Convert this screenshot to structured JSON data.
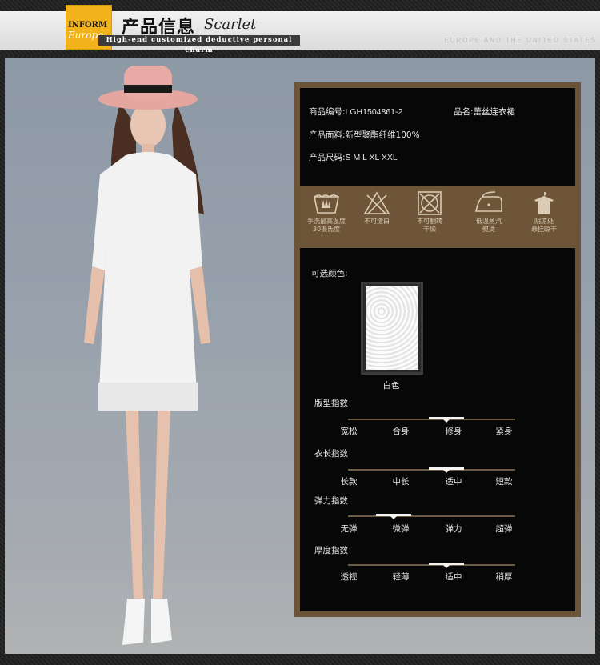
{
  "header": {
    "logo_top": "INFORM",
    "logo_script": "Europe",
    "title_cn": "产品信息",
    "title_en": "Scarlet",
    "subtitle": "High-end customized deductive personal charm",
    "tagline": "EUROPE AND THE UNITED STATES"
  },
  "info": {
    "code_label": "商品编号:",
    "code_value": "LGH1504861-2",
    "name_label": "品名:",
    "name_value": "蕾丝连衣裙",
    "material_label": "产品面料:",
    "material_value": "新型聚酯纤维100%",
    "size_label": "产品尺码:",
    "size_value": "S M L XL XXL"
  },
  "care": [
    {
      "icon": "hand-wash-icon",
      "label1": "手洗最高温度",
      "label2": "30摄氏度"
    },
    {
      "icon": "no-bleach-icon",
      "label1": "不可漂白",
      "label2": ""
    },
    {
      "icon": "no-tumble-dry-icon",
      "label1": "不可翻转",
      "label2": "干燥"
    },
    {
      "icon": "low-iron-icon",
      "label1": "低温蒸汽",
      "label2": "熨烫"
    },
    {
      "icon": "hang-dry-icon",
      "label1": "阴凉处",
      "label2": "悬挂晾干"
    }
  ],
  "colors": {
    "label": "可选颜色:",
    "options": [
      {
        "name": "白色",
        "hex": "#f5f5f5"
      }
    ]
  },
  "scales": [
    {
      "title": "版型指数",
      "options": [
        "宽松",
        "合身",
        "修身",
        "紧身"
      ],
      "selected": "修身"
    },
    {
      "title": "衣长指数",
      "options": [
        "长款",
        "中长",
        "适中",
        "短款"
      ],
      "selected": "适中"
    },
    {
      "title": "弹力指数",
      "options": [
        "无弹",
        "微弹",
        "弹力",
        "超弹"
      ],
      "selected": "微弹"
    },
    {
      "title": "厚度指数",
      "options": [
        "透视",
        "轻薄",
        "适中",
        "稍厚"
      ],
      "selected": "适中"
    }
  ],
  "palette": {
    "accent": "#6e5538",
    "panel": "#080707",
    "logo": "#f2b21b"
  }
}
